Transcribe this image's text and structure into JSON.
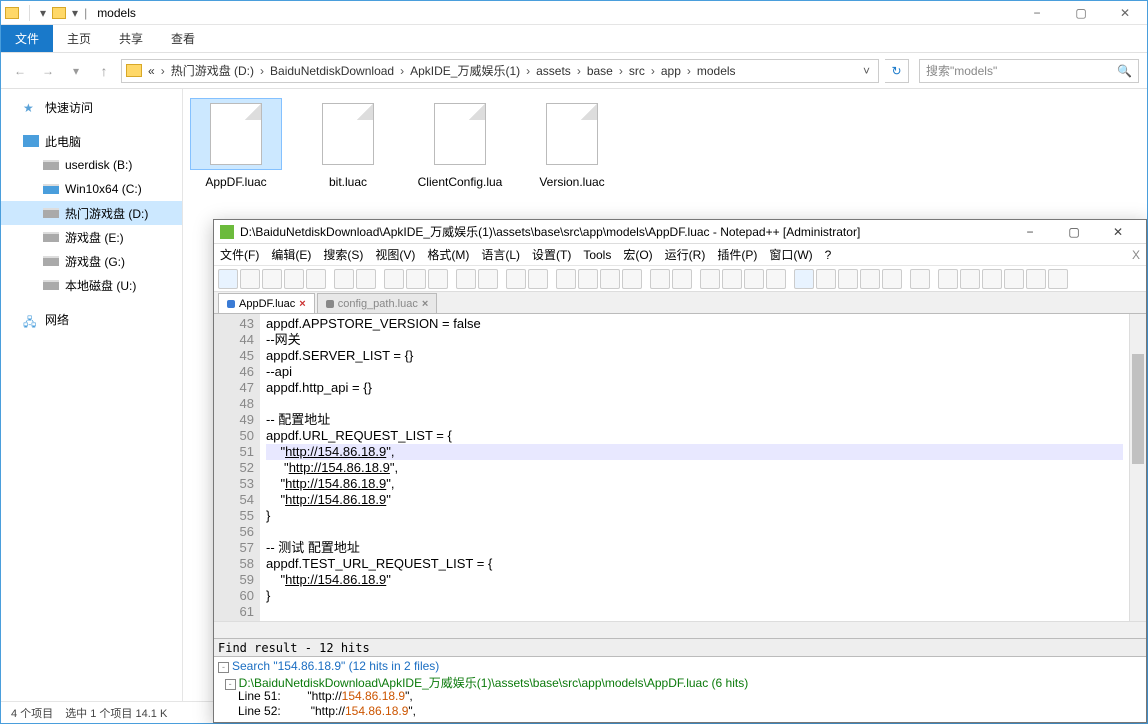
{
  "explorer": {
    "title": "models",
    "ribbon": {
      "file": "文件",
      "home": "主页",
      "share": "共享",
      "view": "查看"
    },
    "breadcrumb": [
      "热门游戏盘 (D:)",
      "BaiduNetdiskDownload",
      "ApkIDE_万威娱乐(1)",
      "assets",
      "base",
      "src",
      "app",
      "models"
    ],
    "search_placeholder": "搜索\"models\"",
    "sidebar": {
      "quick": "快速访问",
      "pc": "此电脑",
      "drives": [
        "userdisk (B:)",
        "Win10x64 (C:)",
        "热门游戏盘 (D:)",
        "游戏盘 (E:)",
        "游戏盘 (G:)",
        "本地磁盘 (U:)"
      ],
      "net": "网络"
    },
    "files": [
      "AppDF.luac",
      "bit.luac",
      "ClientConfig.lua",
      "Version.luac"
    ],
    "status": {
      "count": "4 个项目",
      "sel": "选中 1 个项目  14.1 K"
    }
  },
  "npp": {
    "title": "D:\\BaiduNetdiskDownload\\ApkIDE_万威娱乐(1)\\assets\\base\\src\\app\\models\\AppDF.luac - Notepad++ [Administrator]",
    "menu": [
      "文件(F)",
      "编辑(E)",
      "搜索(S)",
      "视图(V)",
      "格式(M)",
      "语言(L)",
      "设置(T)",
      "Tools",
      "宏(O)",
      "运行(R)",
      "插件(P)",
      "窗口(W)",
      "?"
    ],
    "tabs": {
      "active": "AppDF.luac",
      "inactive": "config_path.luac"
    },
    "line_start": 43,
    "code": [
      "appdf.APPSTORE_VERSION = false",
      "--网关",
      "appdf.SERVER_LIST = {}",
      "--api",
      "appdf.http_api = {}",
      "",
      "-- 配置地址",
      "appdf.URL_REQUEST_LIST = {",
      "    \"http://154.86.18.9\",",
      "     \"http://154.86.18.9\",",
      "    \"http://154.86.18.9\",",
      "    \"http://154.86.18.9\"",
      "}",
      "",
      "-- 测试 配置地址",
      "appdf.TEST_URL_REQUEST_LIST = {",
      "    \"http://154.86.18.9\"",
      "}",
      ""
    ],
    "highlight_line": 51,
    "find": {
      "header": "Find result - 12 hits",
      "search": "Search \"154.86.18.9\" (12 hits in 2 files)",
      "file": "D:\\BaiduNetdiskDownload\\ApkIDE_万威娱乐(1)\\assets\\base\\src\\app\\models\\AppDF.luac (6 hits)",
      "rows": [
        {
          "line": "Line 51:",
          "pre": "    \"http://",
          "hit": "154.86.18.9",
          "post": "\","
        },
        {
          "line": "Line 52:",
          "pre": "     \"http://",
          "hit": "154.86.18.9",
          "post": "\","
        }
      ]
    }
  }
}
